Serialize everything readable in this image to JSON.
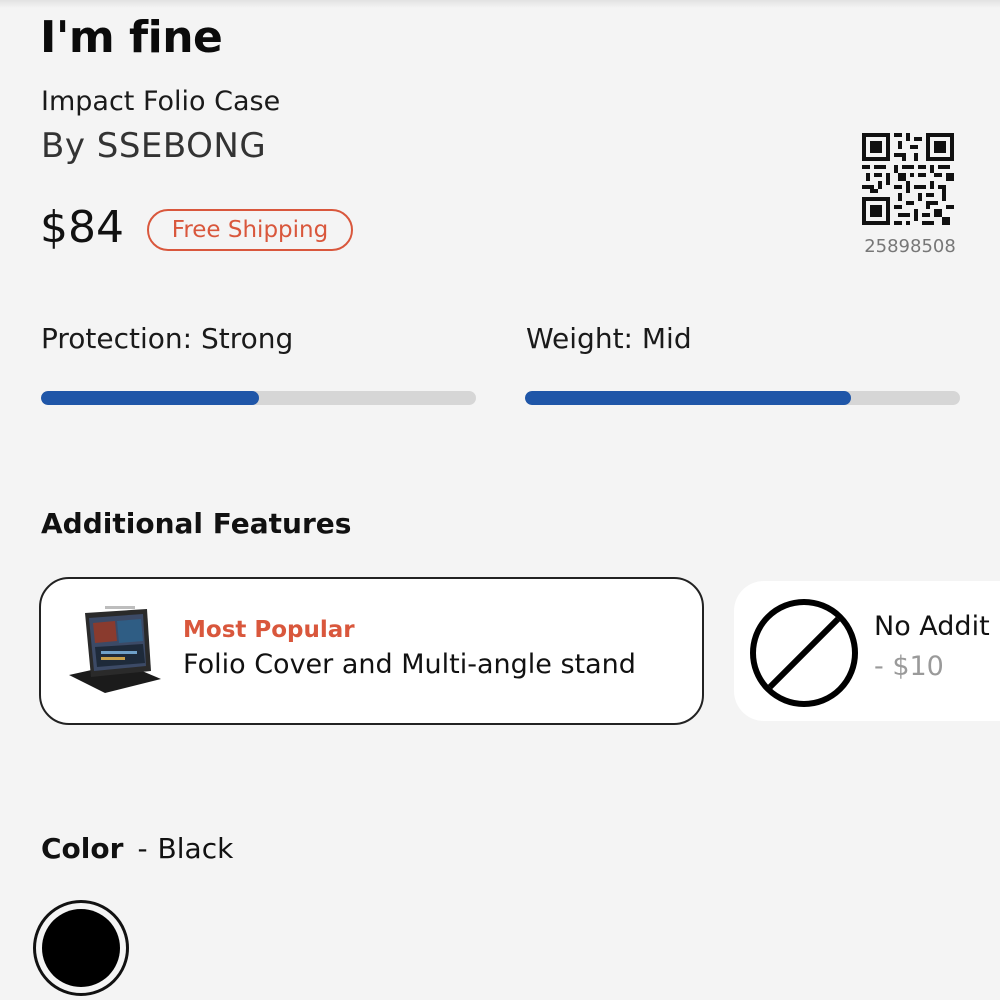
{
  "product": {
    "name": "I'm fine",
    "model": "Impact Folio Case",
    "brand": "By SSEBONG",
    "price": "$84",
    "shipping_badge": "Free Shipping",
    "qr_code_number": "25898508"
  },
  "ratings": [
    {
      "label": "Protection: Strong",
      "level": 0.5
    },
    {
      "label": "Weight: Mid",
      "level": 0.75
    }
  ],
  "additional_features": {
    "title": "Additional Features",
    "options": [
      {
        "tag": "Most Popular",
        "description": "Folio Cover and Multi-angle stand",
        "selected": true,
        "icon": "folio-case-thumbnail"
      },
      {
        "title": "No Addit",
        "price": "- $10",
        "selected": false,
        "icon": "no-sign-icon"
      }
    ]
  },
  "color": {
    "label": "Color",
    "separator": "-",
    "value": "Black",
    "swatches": [
      {
        "name": "Black",
        "hex": "#000000",
        "selected": true
      }
    ]
  },
  "colors": {
    "accent": "#d9573c",
    "bar_fill": "#1f56a8",
    "bar_track": "#d6d6d6"
  }
}
